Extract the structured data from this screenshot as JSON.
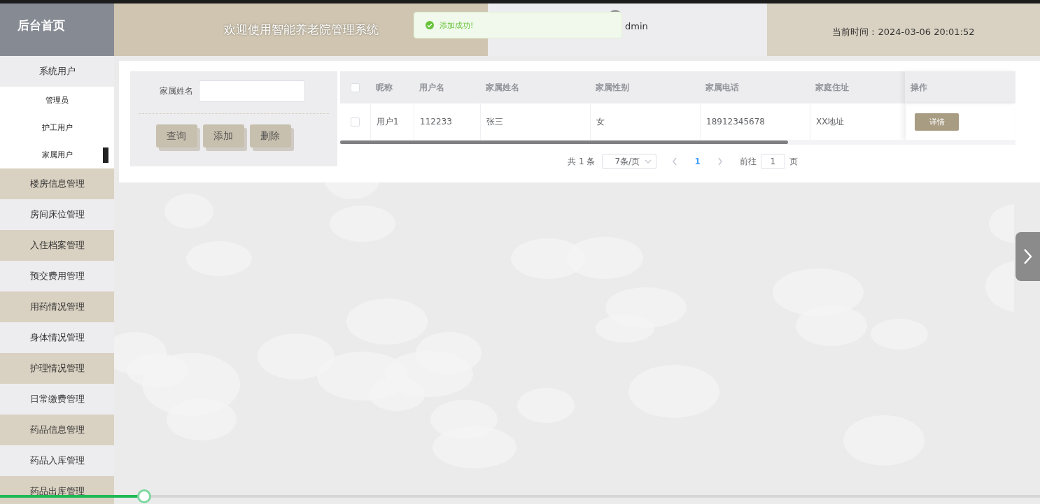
{
  "header": {
    "logo": "后台首页",
    "welcome": "欢迎使用智能养老院管理系统",
    "user": "dmin",
    "time": "当前时间：2024-03-06 20:01:52"
  },
  "toast": {
    "kind": "success",
    "message": "添加成功!"
  },
  "sidebar": {
    "items": [
      {
        "label": "系统用户",
        "expanded": true,
        "children": [
          {
            "label": "管理员",
            "selected": false
          },
          {
            "label": "护工用户",
            "selected": false
          },
          {
            "label": "家属用户",
            "selected": true
          }
        ]
      },
      {
        "label": "楼房信息管理"
      },
      {
        "label": "房间床位管理"
      },
      {
        "label": "入住档案管理"
      },
      {
        "label": "预交费用管理"
      },
      {
        "label": "用药情况管理"
      },
      {
        "label": "身体情况管理"
      },
      {
        "label": "护理情况管理"
      },
      {
        "label": "日常缴费管理"
      },
      {
        "label": "药品信息管理"
      },
      {
        "label": "药品入库管理"
      },
      {
        "label": "药品出库管理"
      }
    ]
  },
  "search": {
    "label": "家属姓名",
    "buttons": [
      "查询",
      "添加",
      "删除"
    ]
  },
  "table": {
    "select_all_checked": false,
    "columns": [
      "昵称",
      "用户名",
      "家属姓名",
      "家属性别",
      "家属电话",
      "家庭住址",
      "操作"
    ],
    "rows": [
      {
        "checked": false,
        "cells": [
          "用户1",
          "112233",
          "张三",
          "女",
          "18912345678",
          "XX地址"
        ],
        "action": "详情"
      }
    ]
  },
  "pagination": {
    "total": "共 1 条",
    "page_size": "7条/页",
    "pages": [
      {
        "label": "1",
        "selected": true
      }
    ],
    "goto_label": "前往",
    "goto_value": "1",
    "page_unit": "页"
  },
  "player": {
    "level": 0.138
  }
}
